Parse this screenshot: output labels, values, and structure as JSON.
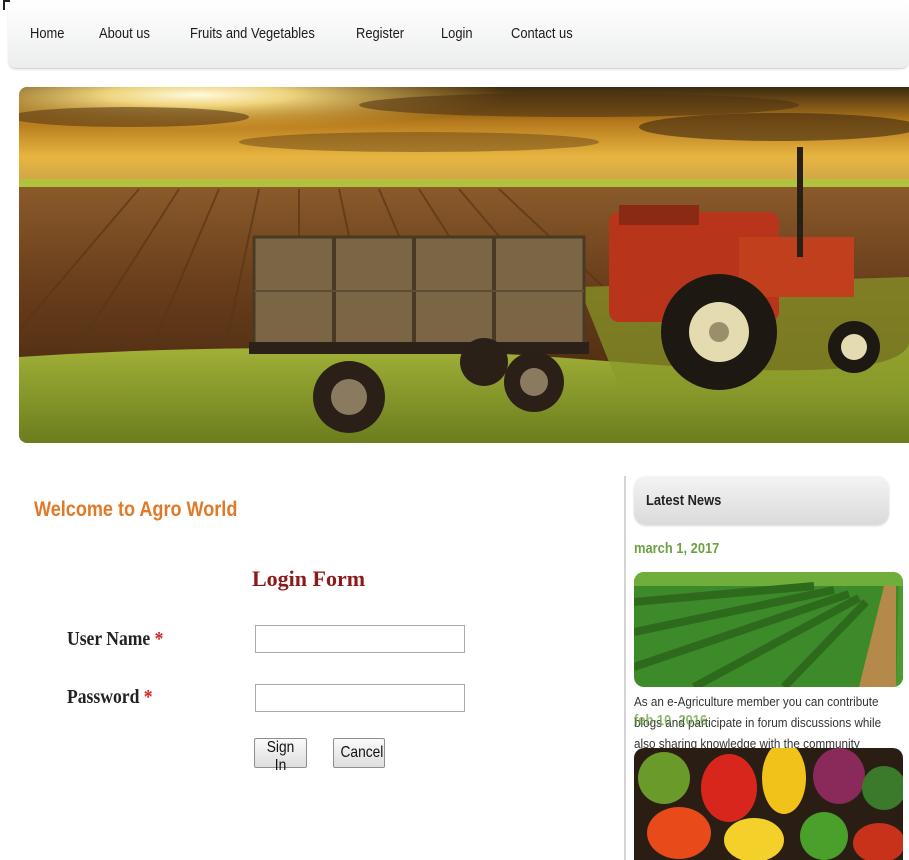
{
  "nav": {
    "items": [
      "Home",
      "About us",
      "Fruits and Vegetables",
      "Register",
      "Login",
      "Contact us"
    ]
  },
  "welcome": "Welcome to Agro World",
  "login_form": {
    "title": "Login Form",
    "username_label": "User Name",
    "password_label": "Password",
    "required_mark": "*",
    "username_value": "",
    "password_value": "",
    "sign_in_label": "Sign In",
    "cancel_label": "Cancel"
  },
  "news": {
    "header": "Latest News",
    "items": [
      {
        "date": "march 1, 2017",
        "text": "As an e-Agriculture member you can contribute blogs and participate in forum discussions while also sharing knowledge with the community"
      },
      {
        "date": "feb 10, 2016",
        "text": ""
      }
    ]
  },
  "colors": {
    "accent_orange": "#e07a28",
    "form_title": "#8b1a1a",
    "news_date_green": "#6aa341",
    "required_red": "#cc2222"
  }
}
